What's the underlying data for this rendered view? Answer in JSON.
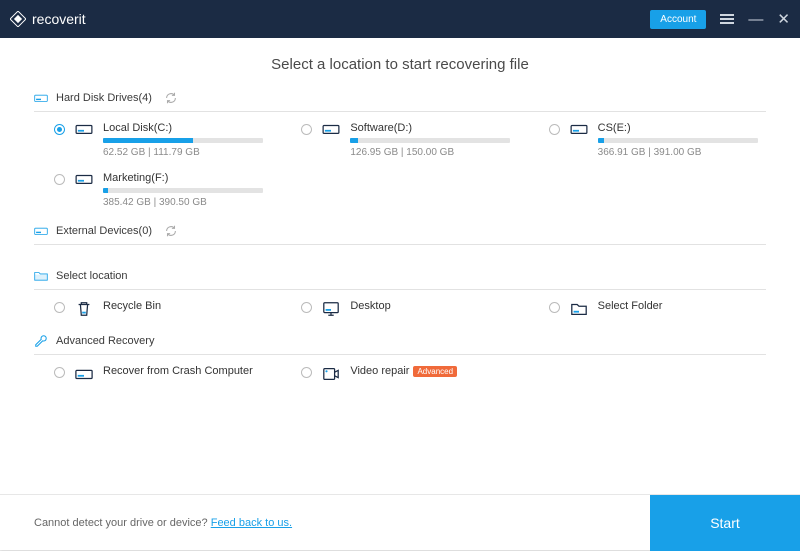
{
  "app": {
    "name": "recoverit"
  },
  "titlebar": {
    "account": "Account"
  },
  "heading": "Select a location to start recovering file",
  "sections": {
    "drives": {
      "label": "Hard Disk Drives(4)"
    },
    "external": {
      "label": "External Devices(0)"
    },
    "select_location": {
      "label": "Select location"
    },
    "advanced": {
      "label": "Advanced Recovery"
    }
  },
  "drives": [
    {
      "label": "Local Disk(C:)",
      "used": 62.52,
      "total": 111.79,
      "size_text": "62.52  GB | 111.79  GB",
      "pct": 56,
      "checked": true
    },
    {
      "label": "Software(D:)",
      "used": 126.95,
      "total": 150.0,
      "size_text": "126.95  GB | 150.00  GB",
      "pct": 5,
      "checked": false
    },
    {
      "label": "CS(E:)",
      "used": 366.91,
      "total": 391.0,
      "size_text": "366.91  GB | 391.00  GB",
      "pct": 4,
      "checked": false
    },
    {
      "label": "Marketing(F:)",
      "used": 385.42,
      "total": 390.5,
      "size_text": "385.42  GB | 390.50  GB",
      "pct": 3,
      "checked": false
    }
  ],
  "locations": {
    "recycle": "Recycle Bin",
    "desktop": "Desktop",
    "folder": "Select Folder"
  },
  "advanced": {
    "crash": "Recover from Crash Computer",
    "video": "Video repair",
    "video_badge": "Advanced"
  },
  "footer": {
    "text": "Cannot detect your drive or device? ",
    "link": "Feed back to us.",
    "start": "Start"
  },
  "colors": {
    "accent": "#18a0e8",
    "header": "#1b2b44",
    "badge": "#f06a3a"
  }
}
